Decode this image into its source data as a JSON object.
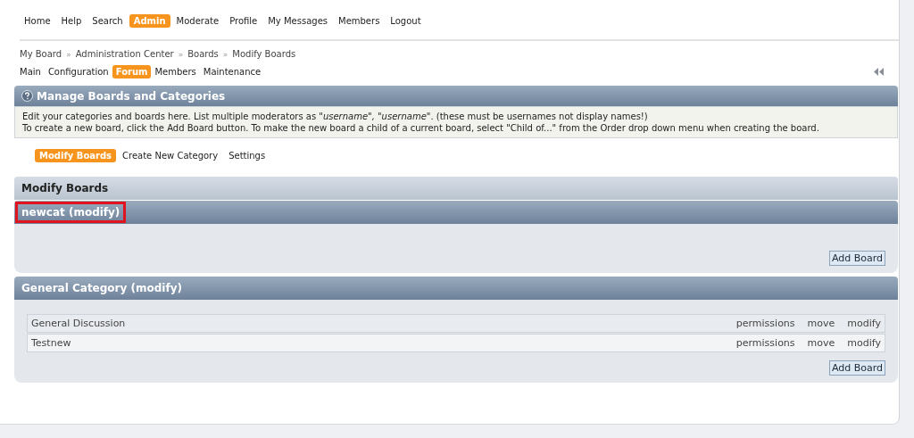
{
  "top_nav": [
    {
      "label": "Home",
      "selected": false
    },
    {
      "label": "Help",
      "selected": false
    },
    {
      "label": "Search",
      "selected": false
    },
    {
      "label": "Admin",
      "selected": true
    },
    {
      "label": "Moderate",
      "selected": false
    },
    {
      "label": "Profile",
      "selected": false
    },
    {
      "label": "My Messages",
      "selected": false
    },
    {
      "label": "Members",
      "selected": false
    },
    {
      "label": "Logout",
      "selected": false
    }
  ],
  "breadcrumb": [
    "My Board",
    "Administration Center",
    "Boards",
    "Modify Boards"
  ],
  "breadcrumb_separator": "»",
  "admin_tabs": [
    {
      "label": "Main",
      "selected": false
    },
    {
      "label": "Configuration",
      "selected": false
    },
    {
      "label": "Forum",
      "selected": true
    },
    {
      "label": "Members",
      "selected": false
    },
    {
      "label": "Maintenance",
      "selected": false
    }
  ],
  "panel": {
    "title": "Manage Boards and Categories",
    "description": [
      "Edit your categories and boards here. List multiple moderators as *\"username\", \"username\"*. (these must be usernames not display names!)",
      "To create a new board, click the Add Board button. To make the new board a child of a current board, select \"Child of...\" from the Order drop down menu when creating the board."
    ]
  },
  "sub_tabs": [
    {
      "label": "Modify Boards",
      "selected": true
    },
    {
      "label": "Create New Category",
      "selected": false
    },
    {
      "label": "Settings",
      "selected": false
    }
  ],
  "modify_boards": {
    "title": "Modify Boards",
    "categories": [
      {
        "title": "newcat (modify)",
        "highlighted": true,
        "add_button": "Add Board"
      },
      {
        "title": "General Category (modify)",
        "highlighted": false,
        "boards": [
          {
            "name": "General Discussion",
            "actions": [
              "permissions",
              "move",
              "modify"
            ]
          },
          {
            "name": "Testnew",
            "actions": [
              "permissions",
              "move",
              "modify"
            ]
          }
        ],
        "add_button": "Add Board"
      }
    ]
  }
}
